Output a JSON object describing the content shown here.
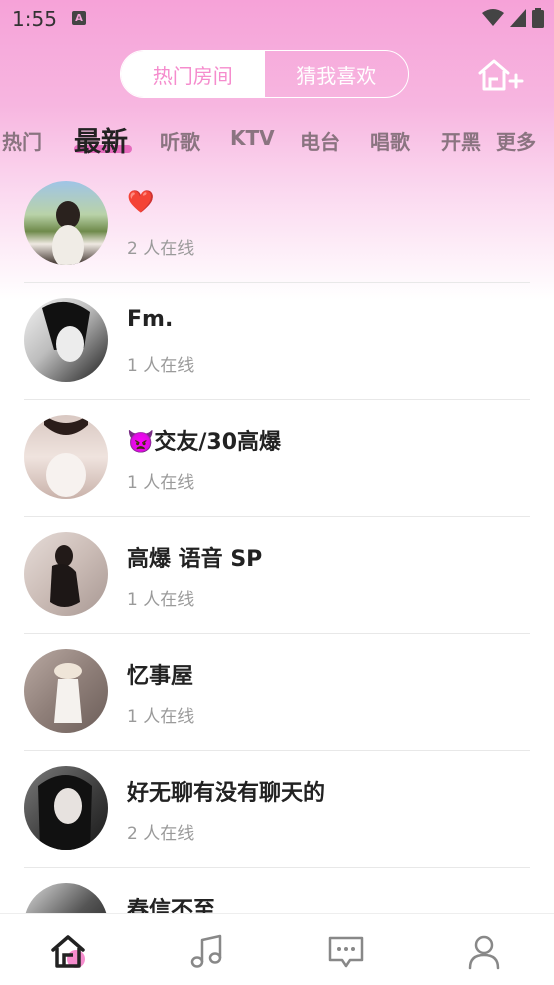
{
  "status_bar": {
    "time": "1:55",
    "notif_letter": "A"
  },
  "header": {
    "segments": [
      {
        "label": "热门房间",
        "active": true
      },
      {
        "label": "猜我喜欢",
        "active": false
      }
    ],
    "create_room_icon": "home-plus-icon"
  },
  "categories": [
    {
      "label": "热门",
      "active": false
    },
    {
      "label": "最新",
      "active": true
    },
    {
      "label": "听歌",
      "active": false
    },
    {
      "label": "KTV",
      "active": false
    },
    {
      "label": "电台",
      "active": false
    },
    {
      "label": "唱歌",
      "active": false
    },
    {
      "label": "开黑",
      "active": false
    },
    {
      "label": "更多",
      "active": false
    }
  ],
  "rooms": [
    {
      "title": "❤️",
      "online": "2 人在线"
    },
    {
      "title": "Fm.",
      "online": "1 人在线"
    },
    {
      "title": "👿交友/30高爆",
      "online": "1 人在线"
    },
    {
      "title": "高爆  语音  SP",
      "online": "1 人在线"
    },
    {
      "title": "忆事屋",
      "online": "1 人在线"
    },
    {
      "title": "好无聊有没有聊天的",
      "online": "2 人在线"
    },
    {
      "title": "春信不至",
      "online": ""
    }
  ],
  "bottom_nav": [
    {
      "icon": "home-icon",
      "active": true
    },
    {
      "icon": "music-note-icon",
      "active": false
    },
    {
      "icon": "chat-icon",
      "active": false
    },
    {
      "icon": "profile-icon",
      "active": false
    }
  ],
  "colors": {
    "accent": "#f58ccd",
    "underline": "#e56bbd",
    "header_bg": "#f6a2d8"
  }
}
